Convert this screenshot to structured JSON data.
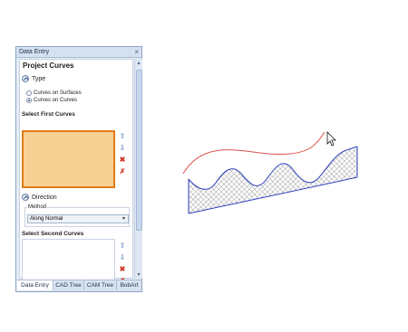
{
  "panel": {
    "title": "Data Entry",
    "close_icon": "close-icon",
    "heading": "Project Curves",
    "type_section": {
      "label": "Type",
      "options": [
        "Curves on Surfaces",
        "Curves on Curves"
      ],
      "selected": "Curves on Curves"
    },
    "select_first": {
      "label": "Select First Curves"
    },
    "direction_section": {
      "label": "Direction",
      "method_label": "Method",
      "method_value": "Along Normal"
    },
    "select_second": {
      "label": "Select Second Curves"
    },
    "list_buttons": [
      "move-up-icon",
      "move-down-icon",
      "remove-icon",
      "remove-all-icon"
    ]
  },
  "tabs": [
    "Data Entry",
    "CAD Tree",
    "CAM Tree",
    "BobArt"
  ],
  "active_tab": "Data Entry",
  "colors": {
    "selection_fill": "#f7d193",
    "selection_border": "#e27b18",
    "curve_red": "#d9534f",
    "curve_blue": "#2d3fbf"
  }
}
